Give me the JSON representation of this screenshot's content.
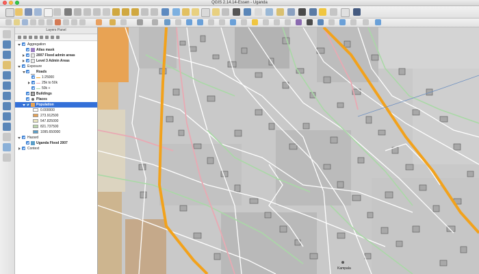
{
  "window": {
    "title": "QGIS 2.14.14-Essen - Uganda"
  },
  "layers_panel": {
    "title": "Layers Panel",
    "items": [
      {
        "label": "Aggregation",
        "bold": false
      },
      {
        "label": "Atlas mask",
        "bold": true
      },
      {
        "label": "2007 Flood admin areas",
        "bold": true
      },
      {
        "label": "Level 3 Admin Areas",
        "bold": true
      },
      {
        "label": "Exposure",
        "bold": false
      },
      {
        "label": "Roads",
        "bold": true
      },
      {
        "label": "1:25000",
        "bold": false
      },
      {
        "label": "25k to 50k",
        "bold": false
      },
      {
        "label": "50k +",
        "bold": false
      },
      {
        "label": "Buildings",
        "bold": true
      },
      {
        "label": "Places",
        "bold": true
      },
      {
        "label": "Population",
        "bold": true
      },
      {
        "label": "0.000000",
        "bold": false
      },
      {
        "label": "273.912500",
        "bold": false
      },
      {
        "label": "547.825000",
        "bold": false
      },
      {
        "label": "821.737500",
        "bold": false
      },
      {
        "label": "1095.650000",
        "bold": false
      },
      {
        "label": "Hazard",
        "bold": false
      },
      {
        "label": "Uganda Flood 2007",
        "bold": true
      },
      {
        "label": "Context",
        "bold": false
      }
    ],
    "legend_colors": [
      "#ffffff",
      "#e8a354",
      "#eae6c0",
      "#bcd7ad",
      "#5b9ec8"
    ]
  },
  "map": {
    "place_labels": [
      "Kampala"
    ],
    "colors": {
      "background": "#c9c9c9",
      "major_road": "#f2a21c",
      "secondary_road": "#e9a9b3",
      "tertiary_road": "#a9d9a6",
      "building_fill": "#a8a8a8",
      "building_outline": "#555555"
    }
  }
}
